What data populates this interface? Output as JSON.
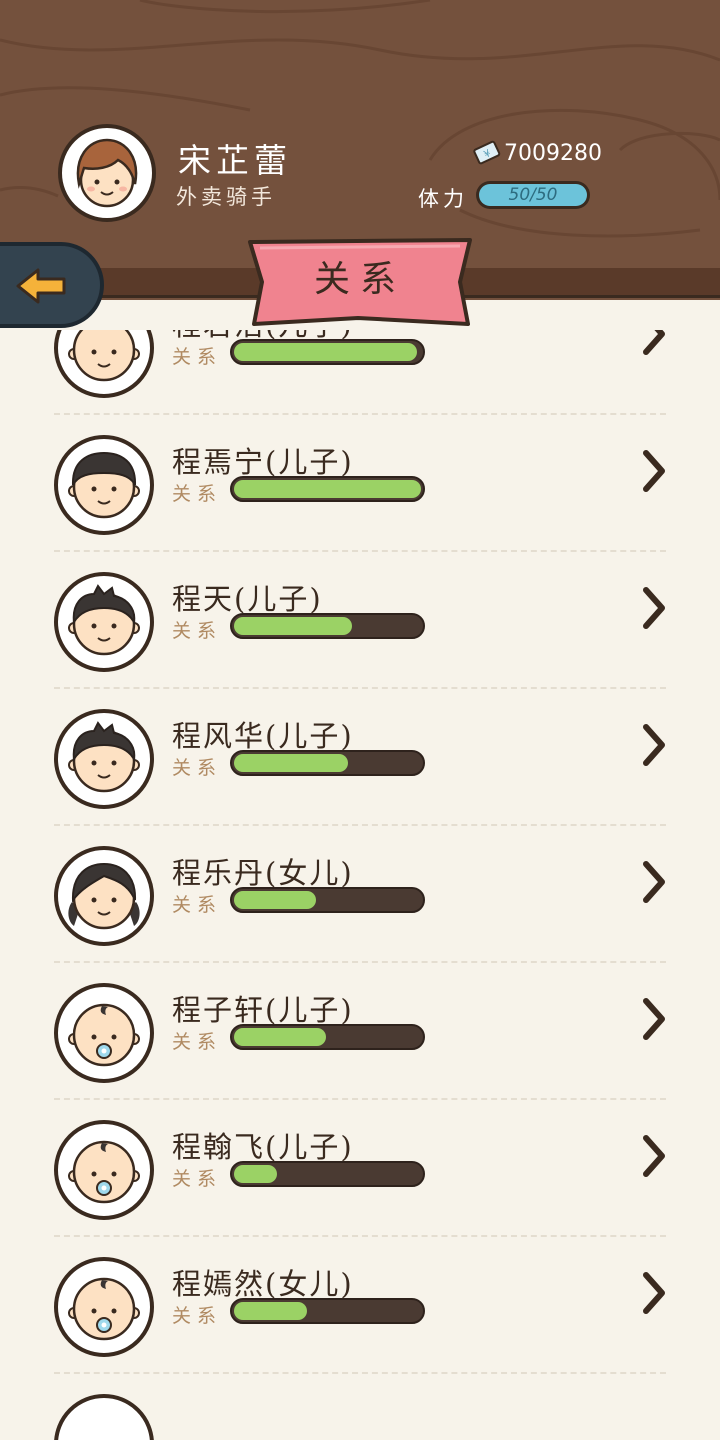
{
  "player": {
    "name": "宋芷蕾",
    "job": "外卖骑手",
    "money": "7009280",
    "stamina_label": "体力",
    "stamina_text": "50/50",
    "stamina_fraction": 1.0
  },
  "screen": {
    "title": "关系"
  },
  "icons": {
    "back": "back-arrow-icon",
    "money": "money-note-icon",
    "chevron": "chevron-right-icon"
  },
  "colors": {
    "header_wood": "#74513d",
    "back_button": "#33434f",
    "arrow": "#f5b23a",
    "banner": "#f0838f",
    "stamina": "#6cc3da",
    "relationship_bar": "#9bd265",
    "bar_track": "#4a3a32",
    "list_bg": "#f7f3ea"
  },
  "relations": [
    {
      "name": "程君浩(儿子)",
      "label": "关系",
      "level": 0.98,
      "avatar": "baby-bald-avatar"
    },
    {
      "name": "程焉宁(儿子)",
      "label": "关系",
      "level": 1.0,
      "avatar": "boy-bowl-hair-avatar"
    },
    {
      "name": "程天(儿子)",
      "label": "关系",
      "level": 0.63,
      "avatar": "boy-spiky-hair-avatar"
    },
    {
      "name": "程风华(儿子)",
      "label": "关系",
      "level": 0.61,
      "avatar": "boy-spiky-hair-avatar"
    },
    {
      "name": "程乐丹(女儿)",
      "label": "关系",
      "level": 0.44,
      "avatar": "girl-pigtails-avatar"
    },
    {
      "name": "程子轩(儿子)",
      "label": "关系",
      "level": 0.49,
      "avatar": "baby-pacifier-avatar"
    },
    {
      "name": "程翰飞(儿子)",
      "label": "关系",
      "level": 0.23,
      "avatar": "baby-pacifier-avatar"
    },
    {
      "name": "程嫣然(女儿)",
      "label": "关系",
      "level": 0.39,
      "avatar": "baby-pacifier-avatar"
    }
  ]
}
